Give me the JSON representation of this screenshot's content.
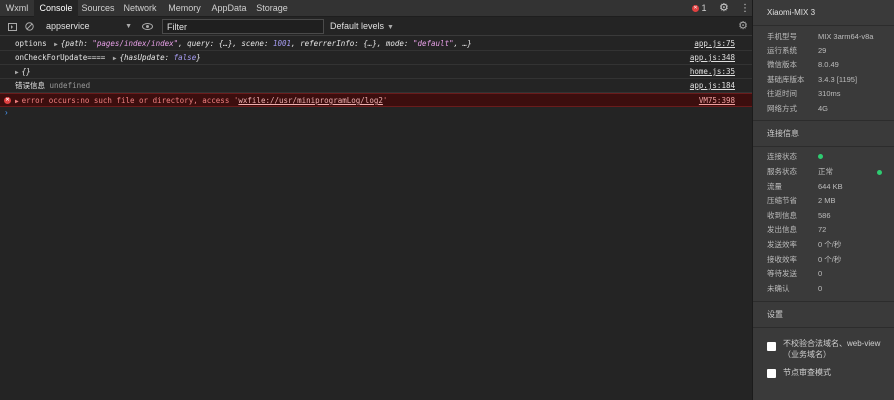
{
  "tabs": [
    "Wxml",
    "Console",
    "Sources",
    "Network",
    "Memory",
    "AppData",
    "Storage"
  ],
  "active_tab": "Console",
  "error_count": "1",
  "toolbar": {
    "context": "appservice",
    "filter_placeholder": "Filter",
    "levels": "Default levels"
  },
  "console": {
    "row1": {
      "label": "options",
      "text_a": "{path: ",
      "path_val": "\"pages/index/index\"",
      "text_b": ", query: {…}, scene: ",
      "scene_val": "1001",
      "text_c": ", referrerInfo: {…}, mode: ",
      "mode_val": "\"default\"",
      "text_d": ", …}",
      "source": "app.js:75"
    },
    "row2": {
      "label": "onCheckForUpdate====",
      "text_a": "{hasUpdate: ",
      "bool_val": "false",
      "text_b": "}",
      "source": "app.js:348"
    },
    "row3": {
      "text": "{}",
      "source": "home.js:35"
    },
    "row4": {
      "label": "错误信息",
      "value": "undefined",
      "source": "app.js:184"
    },
    "error": {
      "text_a": "error occurs:no such file or directory, access '",
      "link": "wxfile://usr/miniprogramLog/log2",
      "text_b": "'",
      "source": "VM75:398"
    }
  },
  "device": {
    "name": "Xiaomi-MIX 3",
    "info": [
      {
        "label": "手机型号",
        "value": "MIX 3arm64-v8a"
      },
      {
        "label": "运行系统",
        "value": "29"
      },
      {
        "label": "微信版本",
        "value": "8.0.49"
      },
      {
        "label": "基础库版本",
        "value": "3.4.3 [1195]"
      },
      {
        "label": "往返时间",
        "value": "310ms"
      },
      {
        "label": "网络方式",
        "value": "4G"
      }
    ]
  },
  "connection": {
    "title": "连接信息",
    "rows": [
      {
        "label": "连接状态",
        "value": ""
      },
      {
        "label": "服务状态",
        "value": "正常"
      },
      {
        "label": "流量",
        "value": "644 KB"
      },
      {
        "label": "压缩节省",
        "value": "2 MB"
      },
      {
        "label": "收到信息",
        "value": "586"
      },
      {
        "label": "发出信息",
        "value": "72"
      },
      {
        "label": "发送效率",
        "value": "0 个/秒"
      },
      {
        "label": "接收效率",
        "value": "0 个/秒"
      },
      {
        "label": "等待发送",
        "value": "0"
      },
      {
        "label": "未确认",
        "value": "0"
      }
    ],
    "status_color": "#2ecc71"
  },
  "settings": {
    "title": "设置",
    "option1": "不校验合法域名、web-view（业务域名）",
    "option2": "节点审查模式"
  }
}
